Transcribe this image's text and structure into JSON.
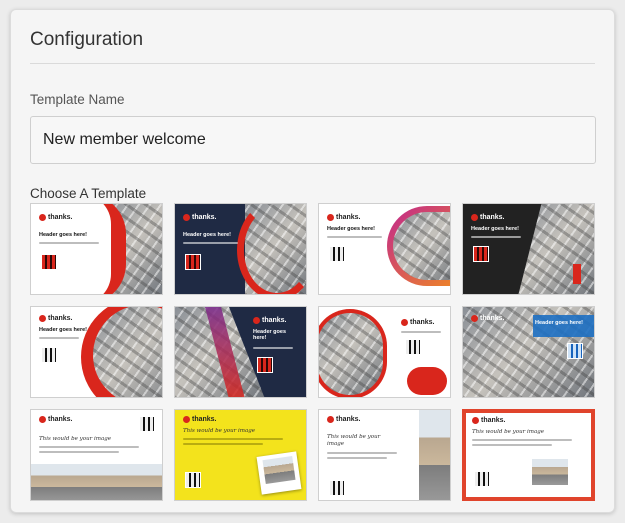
{
  "panel": {
    "title": "Configuration"
  },
  "template_name": {
    "label": "Template Name",
    "value": "New member welcome"
  },
  "chooser": {
    "label": "Choose A Template",
    "templates": [
      {
        "logo": "thanks.",
        "header": "Header goes here!",
        "style": "red-wave"
      },
      {
        "logo": "thanks.",
        "header": "Header goes here!",
        "style": "navy-red-arc"
      },
      {
        "logo": "thanks.",
        "header": "Header goes here!",
        "style": "white-pill"
      },
      {
        "logo": "thanks.",
        "header": "Header goes here!",
        "style": "black-photo"
      },
      {
        "logo": "thanks.",
        "header": "Header goes here!",
        "style": "red-circle"
      },
      {
        "logo": "thanks.",
        "header": "Header goes here!",
        "style": "purple-slant"
      },
      {
        "logo": "thanks.",
        "header": "",
        "style": "red-blob"
      },
      {
        "logo": "thanks.",
        "header": "Header goes here!",
        "style": "blue-photo"
      },
      {
        "logo": "thanks.",
        "header": "This would be your image",
        "style": "street-bottom"
      },
      {
        "logo": "thanks.",
        "header": "This would be your image",
        "style": "yellow-polaroid"
      },
      {
        "logo": "thanks.",
        "header": "This would be your image",
        "style": "street-right"
      },
      {
        "logo": "thanks.",
        "header": "This would be your image",
        "style": "red-border"
      }
    ]
  },
  "colors": {
    "accent_red": "#d9261c",
    "navy": "#1f2a44",
    "yellow": "#f3e31c",
    "blue": "#1d6fc2"
  }
}
